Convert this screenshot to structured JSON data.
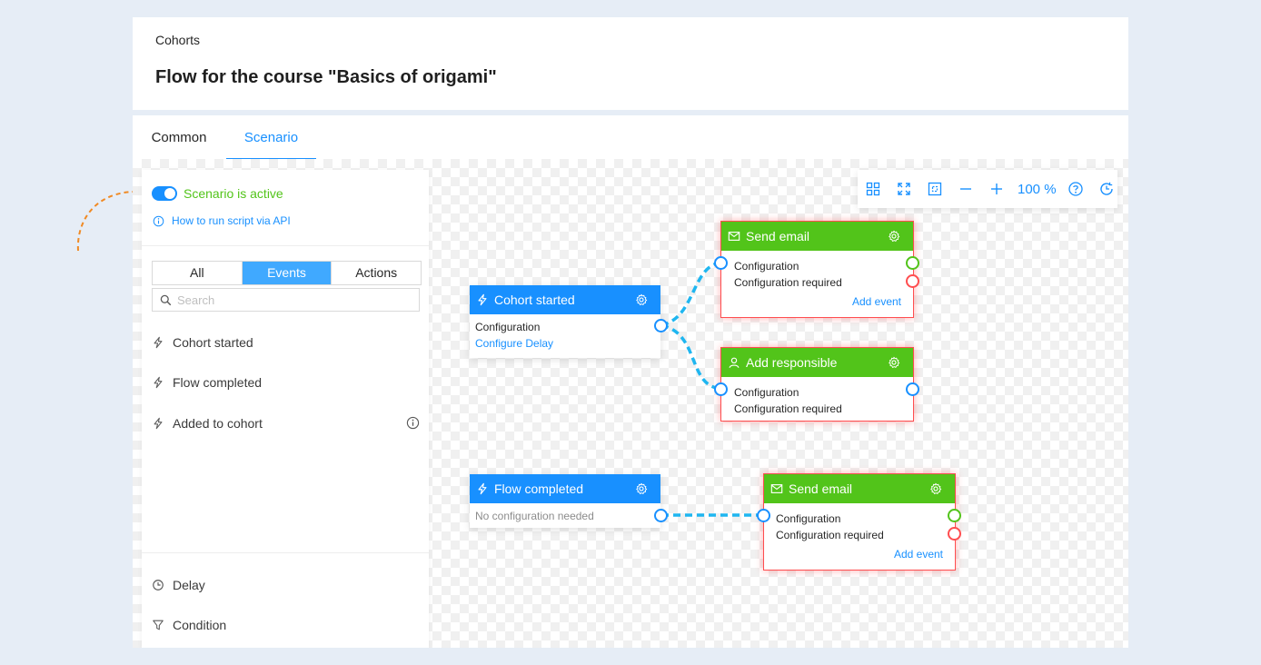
{
  "header": {
    "breadcrumb": "Cohorts",
    "title": "Flow for the course \"Basics of origami\""
  },
  "tabs": [
    {
      "label": "Common"
    },
    {
      "label": "Scenario"
    }
  ],
  "panel": {
    "active_label": "Scenario is active",
    "api_link": "How to run script via API",
    "filters": [
      "All",
      "Events",
      "Actions"
    ],
    "search_placeholder": "Search",
    "events": [
      {
        "label": "Cohort started"
      },
      {
        "label": "Flow completed"
      },
      {
        "label": "Added to cohort"
      }
    ],
    "actions": [
      {
        "label": "Delay"
      },
      {
        "label": "Condition"
      }
    ]
  },
  "toolbar": {
    "zoom": "100 %"
  },
  "nodes": {
    "cohort_started": {
      "title": "Cohort started",
      "line1": "Configuration",
      "link": "Configure Delay"
    },
    "send_email_1": {
      "title": "Send email",
      "line1": "Configuration",
      "line2": "Configuration required",
      "link": "Add event"
    },
    "add_responsible": {
      "title": "Add responsible",
      "line1": "Configuration",
      "line2": "Configuration required"
    },
    "flow_completed": {
      "title": "Flow completed",
      "muted": "No configuration needed"
    },
    "send_email_2": {
      "title": "Send email",
      "line1": "Configuration",
      "line2": "Configuration required",
      "link": "Add event"
    }
  },
  "colors": {
    "primary": "#1890ff",
    "success": "#52c41a",
    "error": "#ff4d4f",
    "connector": "#1fb6f0",
    "hint_arrow": "#f08a24"
  }
}
